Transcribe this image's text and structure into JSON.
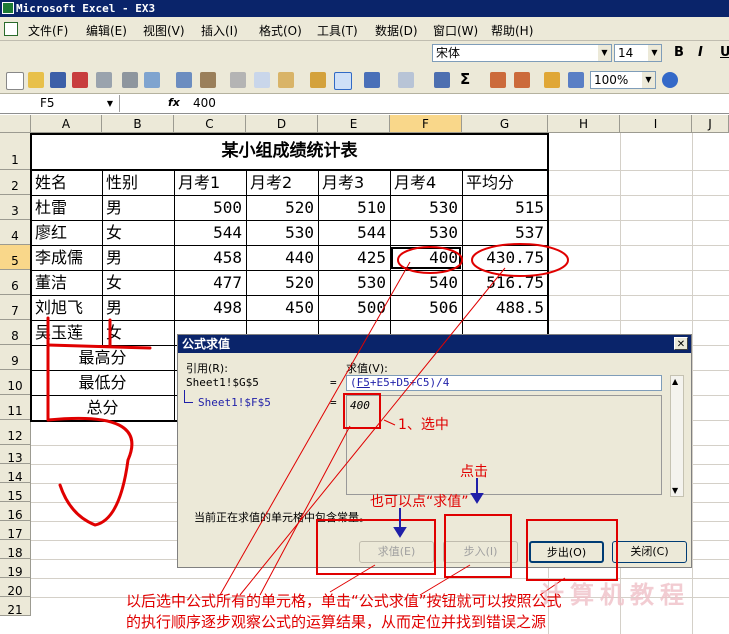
{
  "window": {
    "title": "Microsoft Excel - EX3"
  },
  "menu": [
    "文件(F)",
    "编辑(E)",
    "视图(V)",
    "插入(I)",
    "格式(O)",
    "工具(T)",
    "数据(D)",
    "窗口(W)",
    "帮助(H)"
  ],
  "font_toolbar": {
    "font": "宋体",
    "size": "14",
    "bold": "B",
    "italic": "I",
    "underline": "U"
  },
  "std_toolbar": {
    "zoom": "100%"
  },
  "formula_bar": {
    "name_box": "F5",
    "fx": "fx",
    "value": "400"
  },
  "columns": [
    "A",
    "B",
    "C",
    "D",
    "E",
    "F",
    "G",
    "H",
    "I",
    "J"
  ],
  "rows": [
    "1",
    "2",
    "3",
    "4",
    "5",
    "6",
    "7",
    "8",
    "9",
    "10",
    "11",
    "12",
    "13",
    "14",
    "15",
    "16",
    "17",
    "18",
    "19",
    "20",
    "21"
  ],
  "sheet": {
    "title": "某小组成绩统计表",
    "headers": [
      "姓名",
      "性别",
      "月考1",
      "月考2",
      "月考3",
      "月考4",
      "平均分"
    ],
    "data": [
      {
        "name": "杜雷",
        "gender": "男",
        "m1": "500",
        "m2": "520",
        "m3": "510",
        "m4": "530",
        "avg": "515"
      },
      {
        "name": "廖红",
        "gender": "女",
        "m1": "544",
        "m2": "530",
        "m3": "544",
        "m4": "530",
        "avg": "537"
      },
      {
        "name": "李成儒",
        "gender": "男",
        "m1": "458",
        "m2": "440",
        "m3": "425",
        "m4": "400",
        "avg": "430.75"
      },
      {
        "name": "董洁",
        "gender": "女",
        "m1": "477",
        "m2": "520",
        "m3": "530",
        "m4": "540",
        "avg": "516.75"
      },
      {
        "name": "刘旭飞",
        "gender": "男",
        "m1": "498",
        "m2": "450",
        "m3": "500",
        "m4": "506",
        "avg": "488.5"
      },
      {
        "name": "吴玉莲",
        "gender": "女",
        "m1": "",
        "m2": "",
        "m3": "",
        "m4": "",
        "avg": ""
      }
    ],
    "summary_labels": [
      "最高分",
      "最低分",
      "总分"
    ]
  },
  "dialog": {
    "title": "公式求值",
    "ref_label": "引用(R):",
    "value_label": "求值(V):",
    "ref1": "Sheet1!$G$5",
    "ref2": "Sheet1!$F$5",
    "eq": "=",
    "formula": "(F5+E5+D5+C5)/4",
    "formula_highlight": "F5",
    "formula_rest": "+E5+D5+C5)/4",
    "sub_value": "400",
    "status": "当前正在求值的单元格中包含常量。",
    "btn_evaluate": "求值(E)",
    "btn_step_in": "步入(I)",
    "btn_step_out": "步出(O)",
    "btn_close": "关闭(C)"
  },
  "annotations": {
    "step1": "1、选中",
    "click": "点击",
    "also": "也可以点“求值”",
    "bottom1": "以后选中公式所有的单元格，单击“公式求值”按钮就可以按照公式",
    "bottom2": "的执行顺序逐步观察公式的运算结果，从而定位并找到错误之源",
    "watermark": "计算机教程"
  },
  "colors": {
    "title_bar": "#0a246a",
    "annotation": "#e00000",
    "ui_face": "#ece9d8"
  }
}
